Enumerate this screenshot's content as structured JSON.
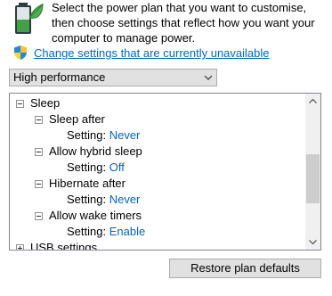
{
  "intro": {
    "text": "Select the power plan that you want to customise, then choose settings that reflect how you want your computer to manage power."
  },
  "link": {
    "text": "Change settings that are currently unavailable"
  },
  "plan_select": {
    "value": "High performance"
  },
  "tree": {
    "sleep": {
      "label": "Sleep",
      "sleep_after": {
        "label": "Sleep after",
        "setting_label": "Setting:",
        "value": "Never"
      },
      "hybrid_sleep": {
        "label": "Allow hybrid sleep",
        "setting_label": "Setting:",
        "value": "Off"
      },
      "hibernate_after": {
        "label": "Hibernate after",
        "setting_label": "Setting:",
        "value": "Never"
      },
      "wake_timers": {
        "label": "Allow wake timers",
        "setting_label": "Setting:",
        "value": "Enable"
      }
    },
    "usb": {
      "label": "USB settings"
    }
  },
  "buttons": {
    "restore": "Restore plan defaults"
  },
  "colors": {
    "link": "#0066cc",
    "button_bg": "#e1e1e1",
    "button_border": "#adadad"
  },
  "icons": {
    "battery": "battery-leaf-icon",
    "shield": "uac-shield-icon",
    "dropdown": "chevron-down-icon",
    "scroll_up": "scroll-up-arrow-icon",
    "scroll_down": "scroll-down-arrow-icon"
  }
}
